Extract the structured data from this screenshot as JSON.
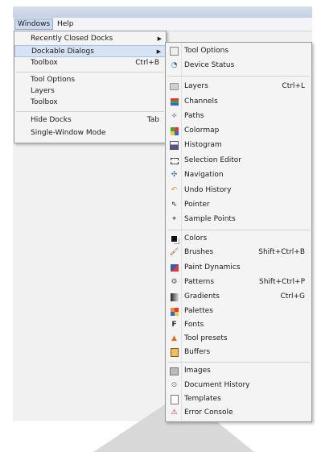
{
  "menubar": {
    "windows": "Windows",
    "help": "Help"
  },
  "windows_menu": {
    "recently_closed": "Recently Closed Docks",
    "dockable": "Dockable Dialogs",
    "toolbox": "Toolbox",
    "toolbox_sc": "Ctrl+B",
    "tool_options": "Tool Options",
    "layers": "Layers",
    "toolbox2": "Toolbox",
    "hide_docks": "Hide Docks",
    "hide_docks_sc": "Tab",
    "single_window": "Single-Window Mode"
  },
  "dockable_menu": {
    "tool_options": "Tool Options",
    "device_status": "Device Status",
    "layers": "Layers",
    "layers_sc": "Ctrl+L",
    "channels": "Channels",
    "paths": "Paths",
    "colormap": "Colormap",
    "histogram": "Histogram",
    "selection_editor": "Selection Editor",
    "navigation": "Navigation",
    "undo_history": "Undo History",
    "pointer": "Pointer",
    "sample_points": "Sample Points",
    "colors": "Colors",
    "brushes": "Brushes",
    "brushes_sc": "Shift+Ctrl+B",
    "paint_dynamics": "Paint Dynamics",
    "patterns": "Patterns",
    "patterns_sc": "Shift+Ctrl+P",
    "gradients": "Gradients",
    "gradients_sc": "Ctrl+G",
    "palettes": "Palettes",
    "fonts": "Fonts",
    "tool_presets": "Tool presets",
    "buffers": "Buffers",
    "images": "Images",
    "document_history": "Document History",
    "templates": "Templates",
    "error_console": "Error Console"
  }
}
